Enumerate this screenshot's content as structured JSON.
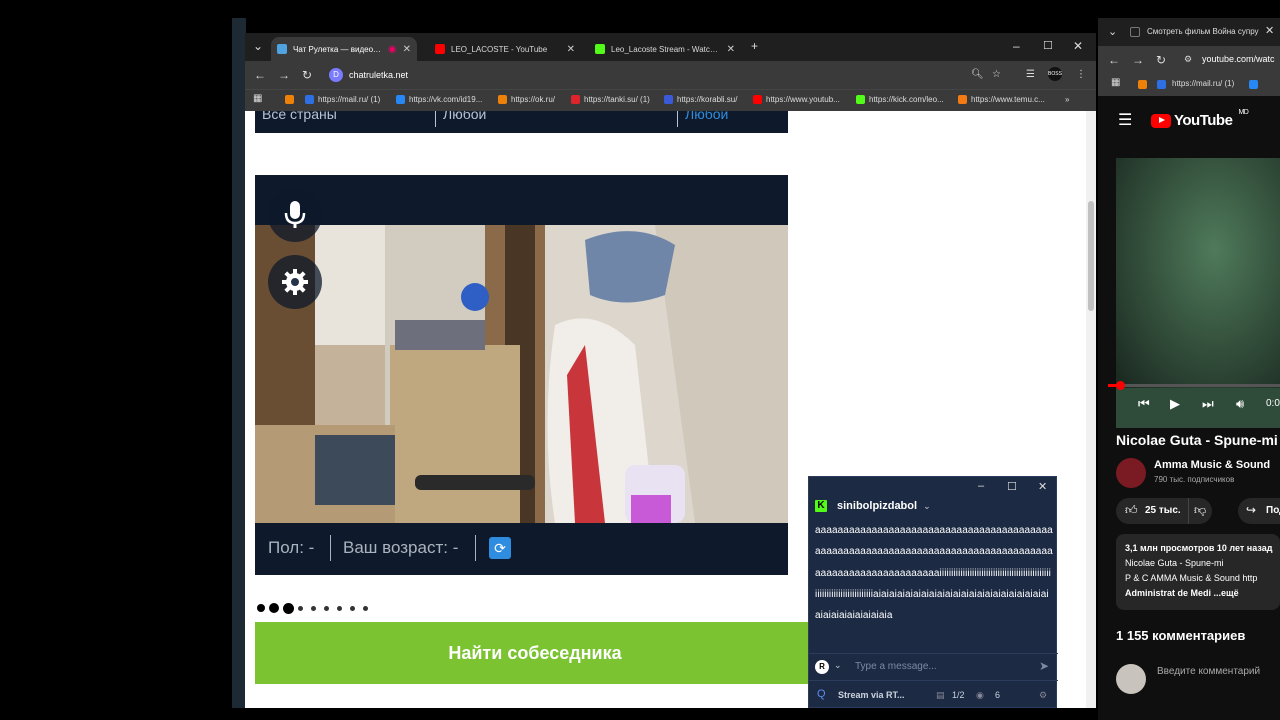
{
  "browser": {
    "tabs": [
      {
        "title": "Чат Рулетка — видеочат с",
        "favicon_color": "#4fa3e0",
        "active": true
      },
      {
        "title": "LEO_LACOSTE - YouTube",
        "favicon_color": "#ff0000",
        "active": false
      },
      {
        "title": "Leo_Lacoste Stream - Watch Li",
        "favicon_color": "#53fc18",
        "active": false
      }
    ],
    "url": "chatruletka.net",
    "bookmarks": [
      {
        "label": "https://mail.ru/ (1)",
        "color": "#2f6fe4"
      },
      {
        "label": "https://vk.com/id19...",
        "color": "#2787f5"
      },
      {
        "label": "https://ok.ru/",
        "color": "#ee8208"
      },
      {
        "label": "https://tanki.su/ (1)",
        "color": "#e0242c"
      },
      {
        "label": "https://korabli.su/",
        "color": "#3a5bd8"
      },
      {
        "label": "https://www.youtub...",
        "color": "#ff0000"
      },
      {
        "label": "https://kick.com/leo...",
        "color": "#53fc18"
      },
      {
        "label": "https://www.temu.c...",
        "color": "#f47a13"
      }
    ]
  },
  "page": {
    "filter": {
      "country": "Все страны",
      "gender": "Любой",
      "pref": "Любой"
    },
    "info": {
      "gender_label": "Пол: -",
      "age_label": "Ваш возраст: -"
    },
    "find_button": "Найти собеседника"
  },
  "chat": {
    "username": "sinibolpizdabol",
    "message": "aaaaaaaaaaaaaaaaaaaaaaaaaaaaaaaaaaaaaaaaaaaaaaaaaaaaaaaaaaaaaaaaaaaaaaaaaaaaaaaaaaaaaaaaaaaaaaaaaaaaaaaaaaiiiiiiiiiiiiiiiiiiiiiiiiiiiiiiiiiiiiiiiiiiiiiiiiiiiiiiiiiiiiiiiiiiiiiiiiiaiaiaiaiaiaiaiaiaiaiaiaiaiaiaiaiaiaiaiaiaiaiaiaiaiaiaiaiaiaiaia",
    "placeholder": "Type a message...",
    "footer_label": "Stream via RT...",
    "page_indicator": "1/2",
    "viewers": "6"
  },
  "youtube": {
    "tab_title": "Смотреть фильм Война супру",
    "url": "youtube.com/watc",
    "bookmark": "https://mail.ru/ (1)",
    "logo": "YouTube",
    "logo_badge": "MD",
    "time": "0:0",
    "video_title": "Nicolae Guta - Spune-mi",
    "channel": "Amma Music & Sound",
    "subscribers": "790 тыс. подписчиков",
    "likes": "25 тыс.",
    "share": "Поде",
    "desc_line1": "3,1 млн просмотров  10 лет назад",
    "desc_line2": "Nicolae Guta - Spune-mi",
    "desc_line3": "P & C AMMA Music & Sound http",
    "desc_line4": "Administrat de  Medi  ...ещё",
    "comments_count": "1 155 комментариев",
    "comment_placeholder": "Введите комментарий"
  }
}
